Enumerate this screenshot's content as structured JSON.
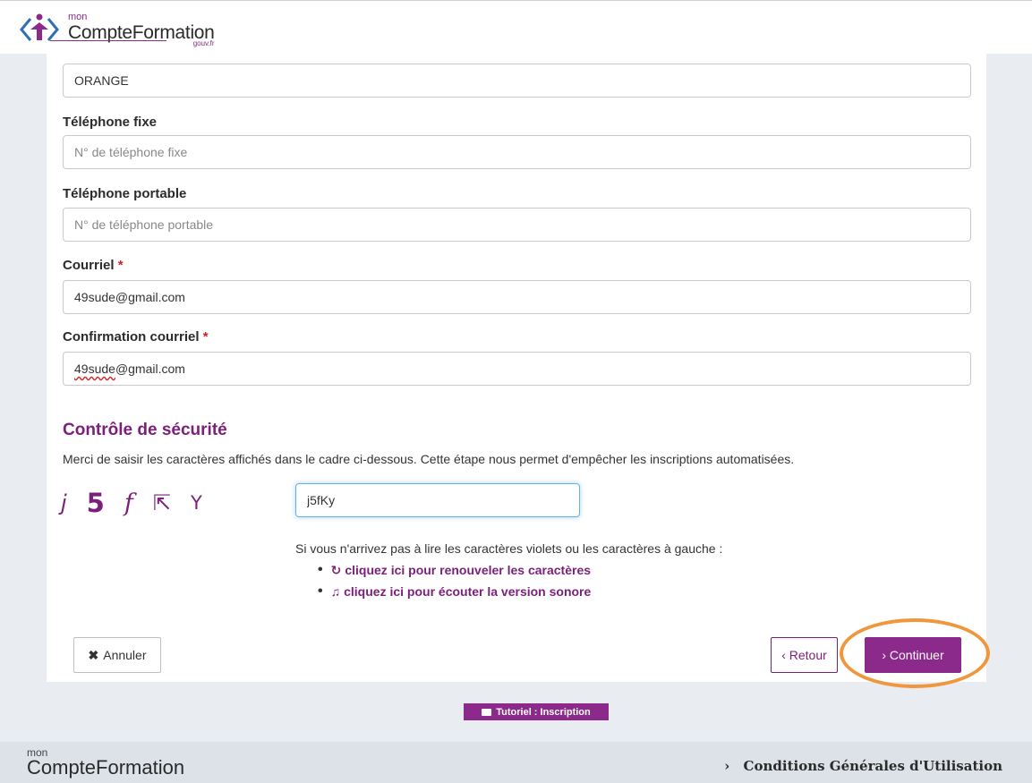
{
  "header": {
    "logo_mon": "mon",
    "logo_name": "CompteFormation",
    "logo_gouv": "gouv.fr"
  },
  "form": {
    "operator_value": "ORANGE",
    "fixed_phone": {
      "label": "Téléphone fixe",
      "placeholder": "N° de téléphone fixe",
      "value": ""
    },
    "mobile_phone": {
      "label": "Téléphone portable",
      "placeholder": "N° de téléphone portable",
      "value": ""
    },
    "email": {
      "label": "Courriel",
      "required_mark": "*",
      "value": "49sude@gmail.com"
    },
    "email_confirm": {
      "label": "Confirmation courriel",
      "required_mark": "*",
      "value_prefix": "49sude",
      "value_suffix": "@gmail.com"
    }
  },
  "security": {
    "title": "Contrôle de sécurité",
    "description": "Merci de saisir les caractères affichés dans le cadre ci-dessous. Cette étape nous permet d'empêcher les inscriptions automatisées.",
    "captcha_chars": [
      "j",
      "5",
      "f",
      "⇱",
      "Y"
    ],
    "captcha_value": "j5fKy",
    "help_text": "Si vous n'arrivez pas à lire les caractères violets ou les caractères à gauche :",
    "renew_icon": "↻",
    "renew_label": "cliquez ici pour renouveler les caractères",
    "audio_icon": "♫",
    "audio_label": "cliquez ici pour écouter la version sonore"
  },
  "actions": {
    "cancel_icon": "✖",
    "cancel_label": "Annuler",
    "back_label": "‹ Retour",
    "continue_label": "› Continuer"
  },
  "tutorial_label": "Tutoriel : Inscription",
  "footer": {
    "logo_mon": "mon",
    "logo_name": "CompteFormation",
    "cgu_chevron": "›",
    "cgu_label": "Conditions Générales d'Utilisation"
  },
  "colors": {
    "brand_purple": "#8b2a8a",
    "highlight_orange": "#f0963c",
    "required_red": "#c0262e"
  }
}
